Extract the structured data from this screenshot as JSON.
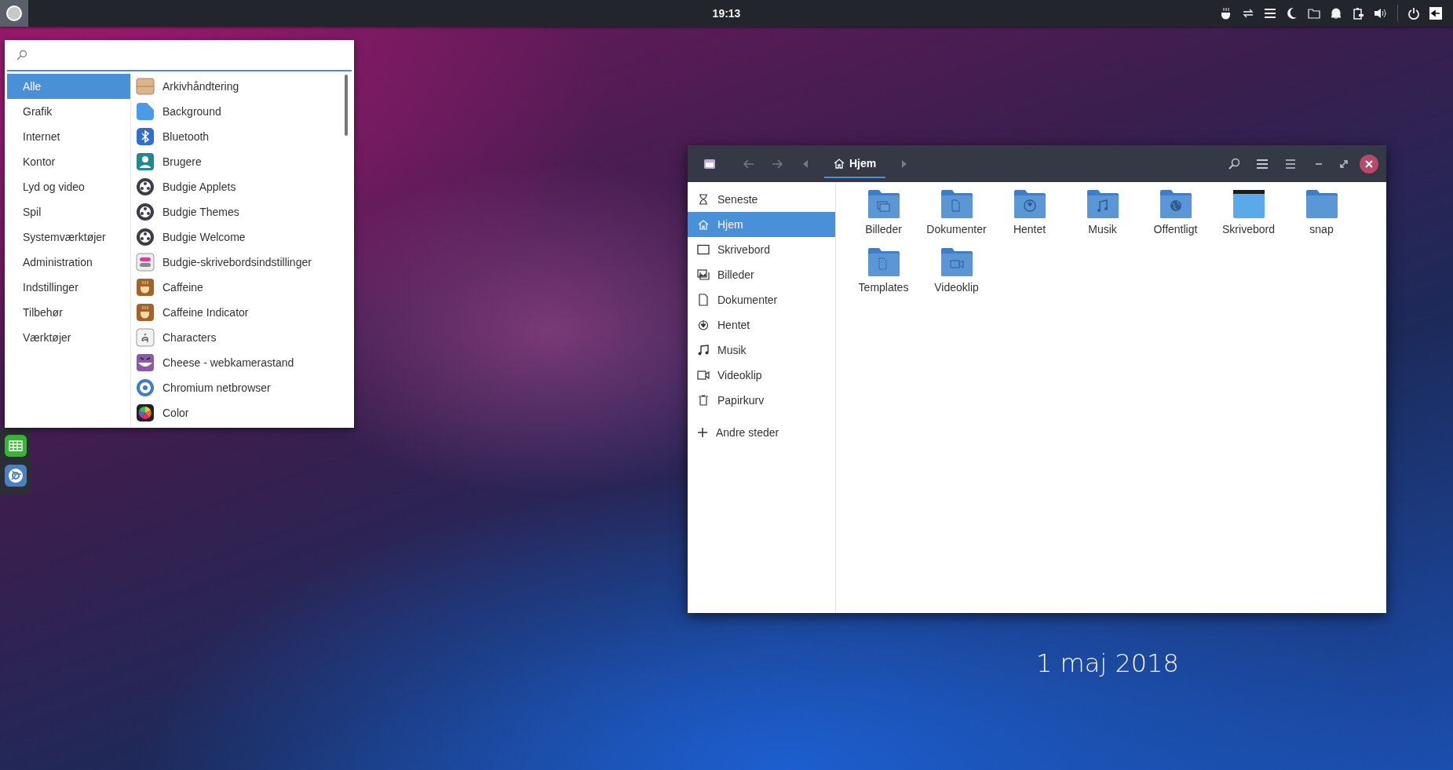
{
  "top_bar": {
    "clock": "19:13"
  },
  "app_menu": {
    "categories": [
      {
        "label": "Alle",
        "selected": true
      },
      {
        "label": "Grafik",
        "selected": false
      },
      {
        "label": "Internet",
        "selected": false
      },
      {
        "label": "Kontor",
        "selected": false
      },
      {
        "label": "Lyd og video",
        "selected": false
      },
      {
        "label": "Spil",
        "selected": false
      },
      {
        "label": "Systemværktøjer",
        "selected": false
      },
      {
        "label": "Administration",
        "selected": false
      },
      {
        "label": "Indstillinger",
        "selected": false
      },
      {
        "label": "Tilbehør",
        "selected": false
      },
      {
        "label": "Værktøjer",
        "selected": false
      }
    ],
    "apps": [
      {
        "name": "Arkivhåndtering",
        "kind": "archive"
      },
      {
        "name": "Background",
        "kind": "wallpaper"
      },
      {
        "name": "Bluetooth",
        "kind": "bluetooth"
      },
      {
        "name": "Brugere",
        "kind": "users"
      },
      {
        "name": "Budgie Applets",
        "kind": "budgie"
      },
      {
        "name": "Budgie Themes",
        "kind": "budgie"
      },
      {
        "name": "Budgie Welcome",
        "kind": "budgie"
      },
      {
        "name": "Budgie-skrivebordsindstillinger",
        "kind": "toggles"
      },
      {
        "name": "Caffeine",
        "kind": "caffeine"
      },
      {
        "name": "Caffeine Indicator",
        "kind": "caffeine"
      },
      {
        "name": "Characters",
        "kind": "characters"
      },
      {
        "name": "Cheese - webkamerastand",
        "kind": "cheese"
      },
      {
        "name": "Chromium netbrowser",
        "kind": "chromium"
      },
      {
        "name": "Color",
        "kind": "color"
      }
    ]
  },
  "file_manager": {
    "path_button": "Hjem",
    "sidebar": [
      {
        "label": "Seneste",
        "kind": "recent",
        "selected": false
      },
      {
        "label": "Hjem",
        "kind": "home",
        "selected": true
      },
      {
        "label": "Skrivebord",
        "kind": "desktop",
        "selected": false
      },
      {
        "label": "Billeder",
        "kind": "pictures",
        "selected": false
      },
      {
        "label": "Dokumenter",
        "kind": "documents",
        "selected": false
      },
      {
        "label": "Hentet",
        "kind": "downloads",
        "selected": false
      },
      {
        "label": "Musik",
        "kind": "music",
        "selected": false
      },
      {
        "label": "Videoklip",
        "kind": "video",
        "selected": false
      },
      {
        "label": "Papirkurv",
        "kind": "trash",
        "selected": false
      }
    ],
    "other_places": "Andre steder",
    "items": [
      {
        "name": "Billeder",
        "kind": "pictures"
      },
      {
        "name": "Dokumenter",
        "kind": "documents"
      },
      {
        "name": "Hentet",
        "kind": "downloads"
      },
      {
        "name": "Musik",
        "kind": "music"
      },
      {
        "name": "Offentligt",
        "kind": "public"
      },
      {
        "name": "Skrivebord",
        "kind": "desktop"
      },
      {
        "name": "snap",
        "kind": "plain"
      },
      {
        "name": "Templates",
        "kind": "templates"
      },
      {
        "name": "Videoklip",
        "kind": "video"
      }
    ]
  },
  "desktop": {
    "date": "1 maj 2018"
  }
}
